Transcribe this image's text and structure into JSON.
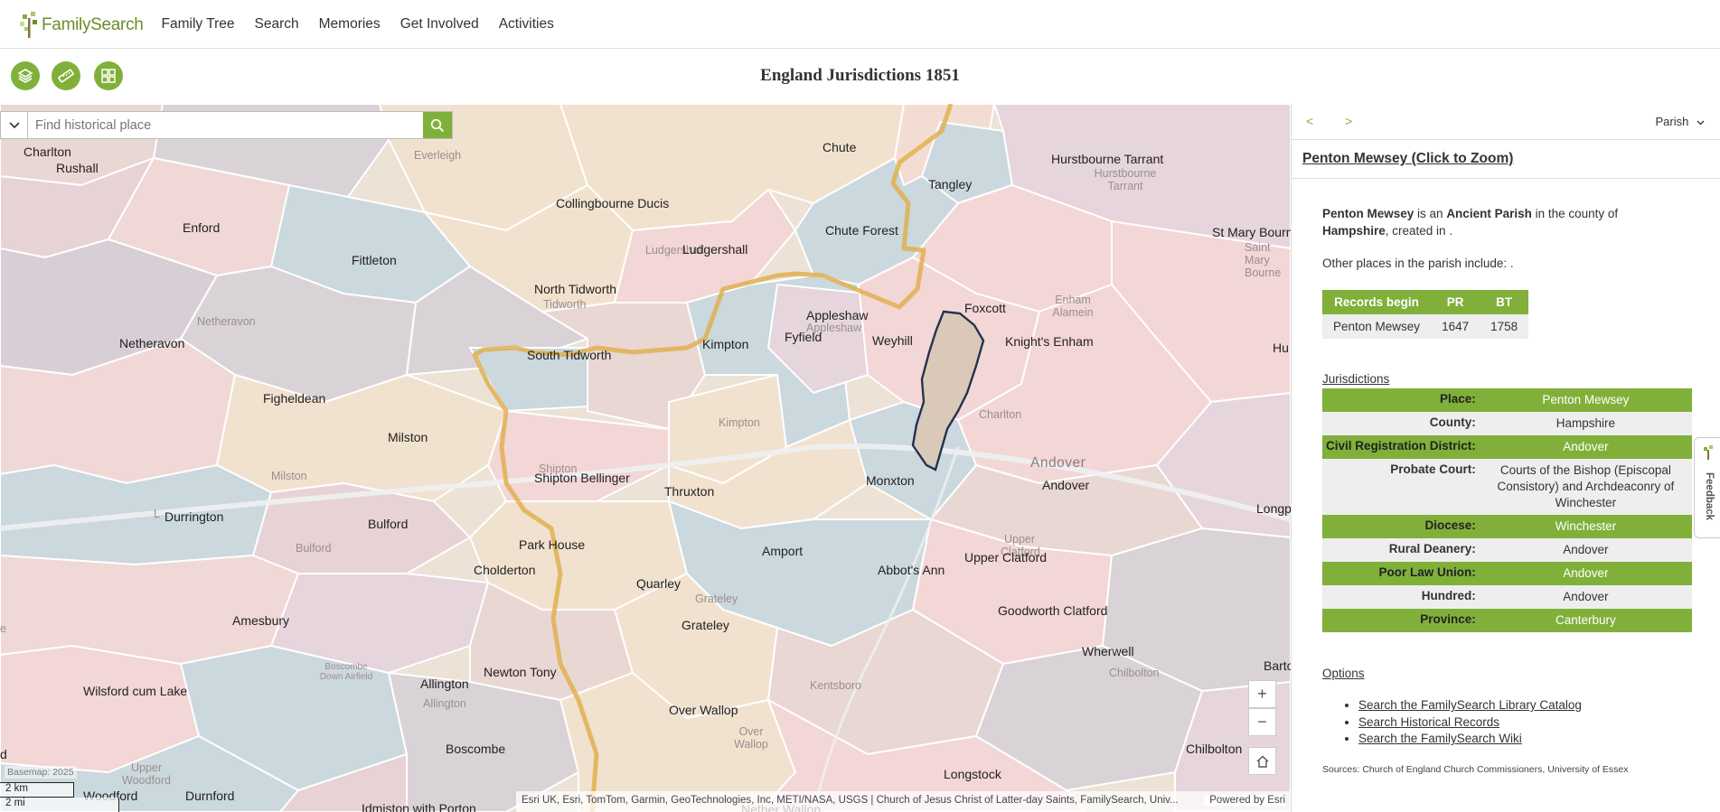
{
  "nav": {
    "logo_text": "FamilySearch",
    "links": [
      "Family Tree",
      "Search",
      "Memories",
      "Get Involved",
      "Activities"
    ]
  },
  "page": {
    "title": "England Jurisdictions 1851"
  },
  "search": {
    "placeholder": "Find historical place"
  },
  "map": {
    "labels": [
      "Charlton",
      "Rushall",
      "Everleigh",
      "Chute",
      "Hurstbourne Tarrant",
      "Hurstbourne Tarrant",
      "Tangley",
      "Collingbourne Ducis",
      "Enford",
      "Chute Forest",
      "St Mary Bourne",
      "Saint Mary Bourne",
      "Ludgershall",
      "Ludgershall",
      "Fittleton",
      "North Tidworth",
      "Tidworth",
      "Enham Alamein",
      "Foxcott",
      "Appleshaw",
      "Appleshaw",
      "Netheravon",
      "Netheravon",
      "Kimpton",
      "Fyfield",
      "Weyhill",
      "Knight's Enham",
      "Hu",
      "South Tidworth",
      "Figheldean",
      "Kimpton",
      "Charlton",
      "Milston",
      "Milston",
      "Andover",
      "Andover",
      "Shipton Bellinger",
      "Shipton",
      "Monxton",
      "Thruxton",
      "Durrington",
      "Bulford",
      "Bulford",
      "Longp",
      "Upper Clatford",
      "Upper Clatford",
      "Park House",
      "Amport",
      "Cholderton",
      "Abbot's Ann",
      "Quarley",
      "Grateley",
      "Grateley",
      "Goodworth Clatford",
      "Amesbury",
      "Wherwell",
      "Barto",
      "Boscombe Down Airfield",
      "Newton Tony",
      "Allington",
      "Allington",
      "Wilsford cum Lake",
      "Kentsboro",
      "Chilbolton",
      "Over Wallop",
      "Over Wallop",
      "Boscombe",
      "Upper Woodford",
      "Chilbolton",
      "Woodford",
      "Durnford",
      "Longstock",
      "Idmiston with Porton",
      "Nether Wallop",
      "L",
      "d",
      "e"
    ],
    "zoom_in": "+",
    "zoom_out": "−",
    "basemap_note": "Basemap: 2025",
    "scale_km": "2 km",
    "scale_mi": "2 mi",
    "attribution": "Esri UK, Esri, TomTom, Garmin, GeoTechnologies, Inc, METI/NASA, USGS | Church of Jesus Christ of Latter-day Saints, FamilySearch, Univ...",
    "powered_by": "Powered by Esri"
  },
  "sidebar": {
    "prev": "<",
    "next": ">",
    "level": "Parish",
    "place_title": "Penton Mewsey (Click to Zoom)",
    "desc_name": "Penton Mewsey",
    "desc_is": " is an ",
    "desc_type": "Ancient Parish",
    "desc_county_pre": " in the county of ",
    "desc_county": "Hampshire",
    "desc_created": ", created in .",
    "other_places": "Other places in the parish include: .",
    "records": {
      "headers": [
        "Records begin",
        "PR",
        "BT"
      ],
      "rows": [
        [
          "Penton Mewsey",
          "1647",
          "1758"
        ]
      ]
    },
    "jurisdictions_heading": "Jurisdictions",
    "jurisdictions": [
      {
        "key": "Place:",
        "value": "Penton Mewsey"
      },
      {
        "key": "County:",
        "value": "Hampshire"
      },
      {
        "key": "Civil Registration District:",
        "value": "Andover"
      },
      {
        "key": "Probate Court:",
        "value": "Courts of the Bishop (Episcopal Consistory) and Archdeaconry of Winchester"
      },
      {
        "key": "Diocese:",
        "value": "Winchester"
      },
      {
        "key": "Rural Deanery:",
        "value": "Andover"
      },
      {
        "key": "Poor Law Union:",
        "value": "Andover"
      },
      {
        "key": "Hundred:",
        "value": "Andover"
      },
      {
        "key": "Province:",
        "value": "Canterbury"
      }
    ],
    "options_heading": "Options",
    "options": [
      "Search the FamilySearch Library Catalog",
      "Search Historical Records",
      "Search the FamilySearch Wiki"
    ],
    "sources": "Sources: Church of England Church Commissioners, University of Essex"
  },
  "feedback_label": "Feedback",
  "colors": {
    "accent": "#80b03a",
    "county_border": "#e0b050",
    "selected_outline": "#1a2a4a"
  }
}
